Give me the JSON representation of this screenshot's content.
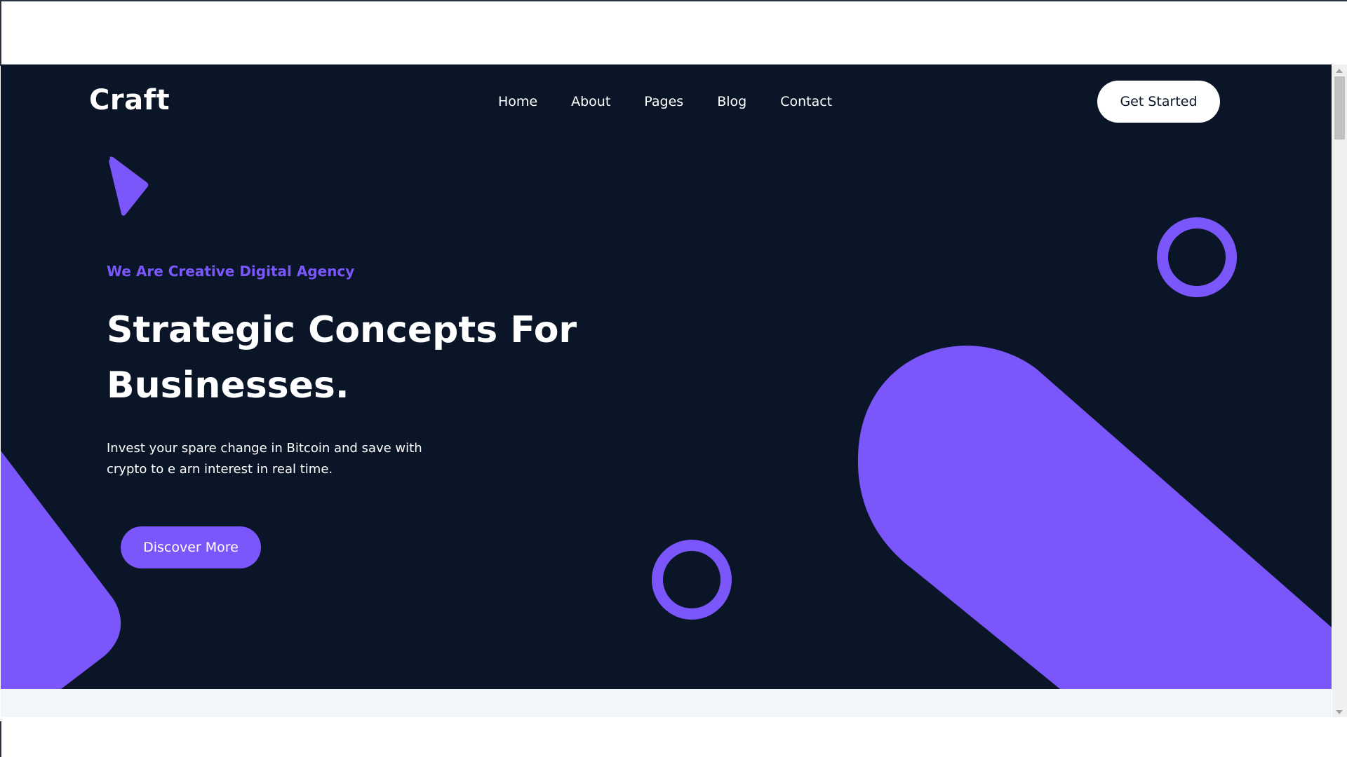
{
  "header": {
    "logo": "Craft",
    "nav": [
      {
        "label": "Home"
      },
      {
        "label": "About"
      },
      {
        "label": "Pages"
      },
      {
        "label": "Blog"
      },
      {
        "label": "Contact"
      }
    ],
    "cta_label": "Get Started"
  },
  "hero": {
    "tagline": "We Are Creative Digital Agency",
    "headline": "Strategic Concepts For Businesses.",
    "description": "Invest your spare change in Bitcoin and save with crypto to e arn interest in real time.",
    "button_label": "Discover More"
  },
  "colors": {
    "hero_background": "#0a1628",
    "accent": "#7b57fb",
    "text": "#ffffff",
    "page_background": "#f3f6f9"
  }
}
